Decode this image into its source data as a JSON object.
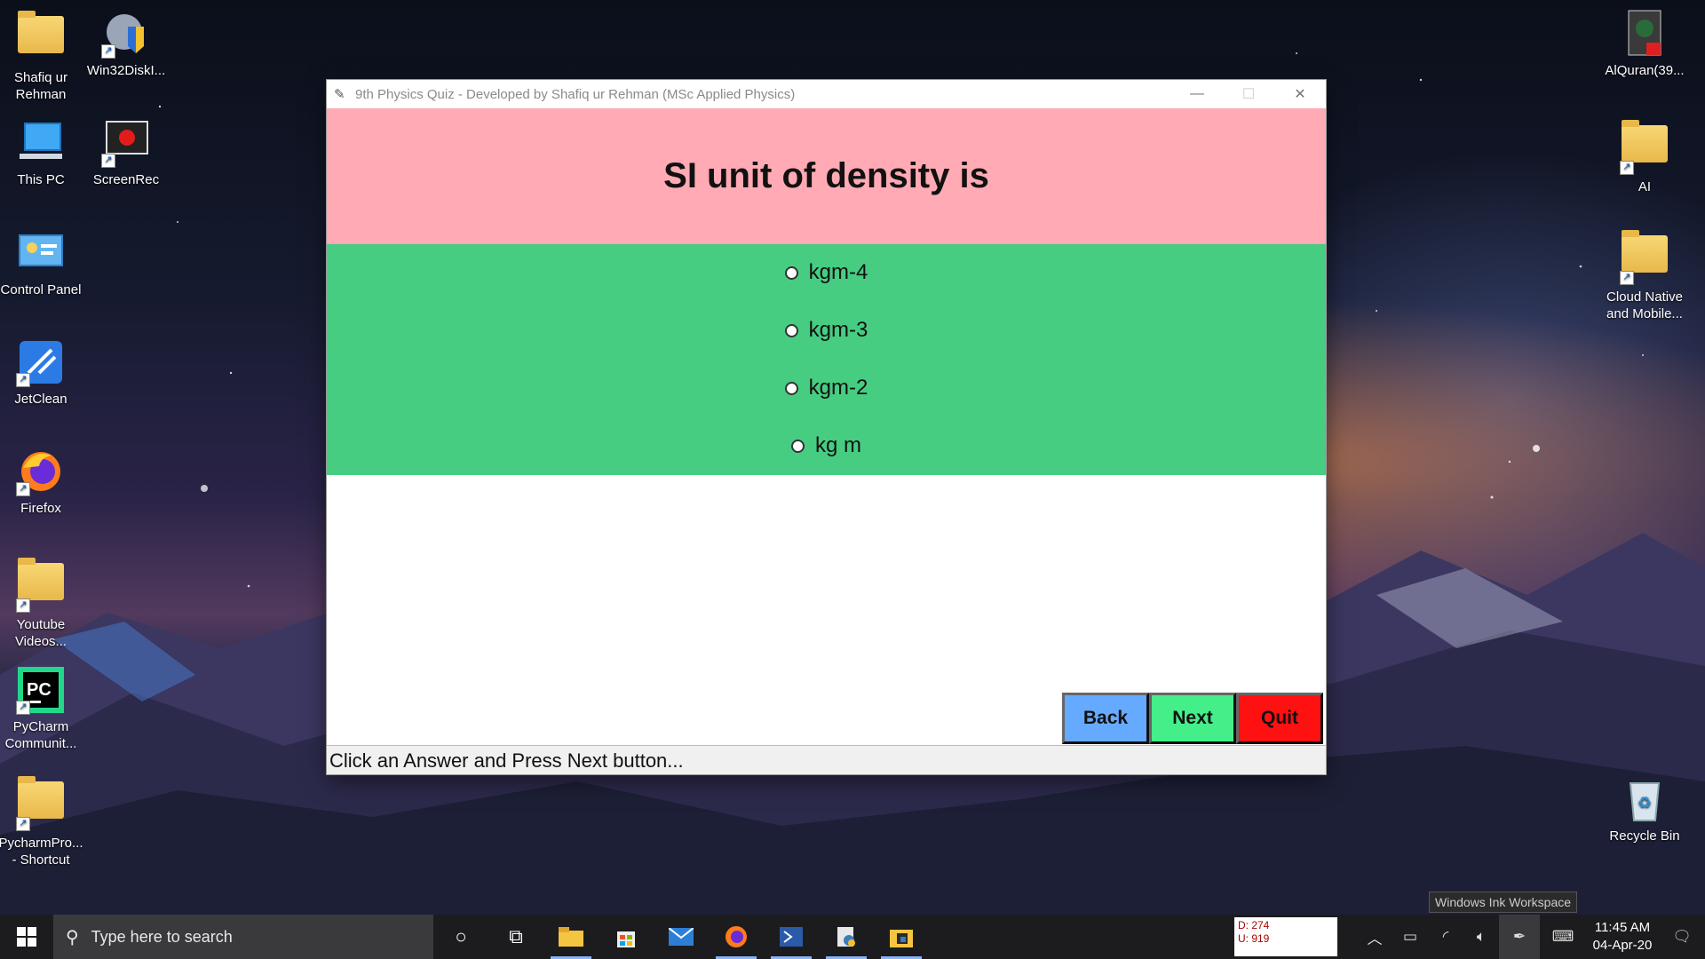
{
  "desktop": {
    "left_icons": [
      {
        "label": "Shafiq ur Rehman",
        "icon": "user-folder-icon"
      },
      {
        "label": "Win32DiskI...",
        "icon": "disk-imager-icon"
      },
      {
        "label": "This PC",
        "icon": "computer-icon"
      },
      {
        "label": "ScreenRec",
        "icon": "screen-recorder-icon"
      },
      {
        "label": "Control Panel",
        "icon": "control-panel-icon"
      },
      {
        "label": "JetClean",
        "icon": "jetclean-icon"
      },
      {
        "label": "Firefox",
        "icon": "firefox-icon"
      },
      {
        "label": "Youtube Videos...",
        "icon": "folder-icon"
      },
      {
        "label": "PyCharm Communit...",
        "icon": "pycharm-icon"
      },
      {
        "label": "PycharmPro... - Shortcut",
        "icon": "folder-icon"
      }
    ],
    "right_icons": [
      {
        "label": "AlQuran(39...",
        "icon": "pdf-icon"
      },
      {
        "label": "AI",
        "icon": "folder-icon"
      },
      {
        "label": "Cloud Native and Mobile...",
        "icon": "folder-icon"
      },
      {
        "label": "Recycle Bin",
        "icon": "recycle-bin-icon"
      }
    ]
  },
  "window": {
    "title": "9th Physics Quiz - Developed by Shafiq ur Rehman (MSc Applied Physics)",
    "minimize": "—",
    "maximize": "☐",
    "close": "✕"
  },
  "quiz": {
    "question": "SI unit of density is",
    "options": [
      "kgm-4",
      "kgm-3",
      "kgm-2",
      "kg m"
    ],
    "buttons": {
      "back": "Back",
      "next": "Next",
      "quit": "Quit"
    },
    "status": "Click an Answer and Press Next button...",
    "colors": {
      "question_bg": "#ffaab4",
      "answers_bg": "#46cd82",
      "back": "#66aaff",
      "next": "#44ee88",
      "quit": "#ff1111"
    }
  },
  "taskbar": {
    "search_placeholder": "Type here to search",
    "net_meter": {
      "down": "D: 274",
      "up": "U: 919"
    },
    "ink_tooltip": "Windows Ink Workspace",
    "time": "11:45 AM",
    "date": "04-Apr-20"
  }
}
